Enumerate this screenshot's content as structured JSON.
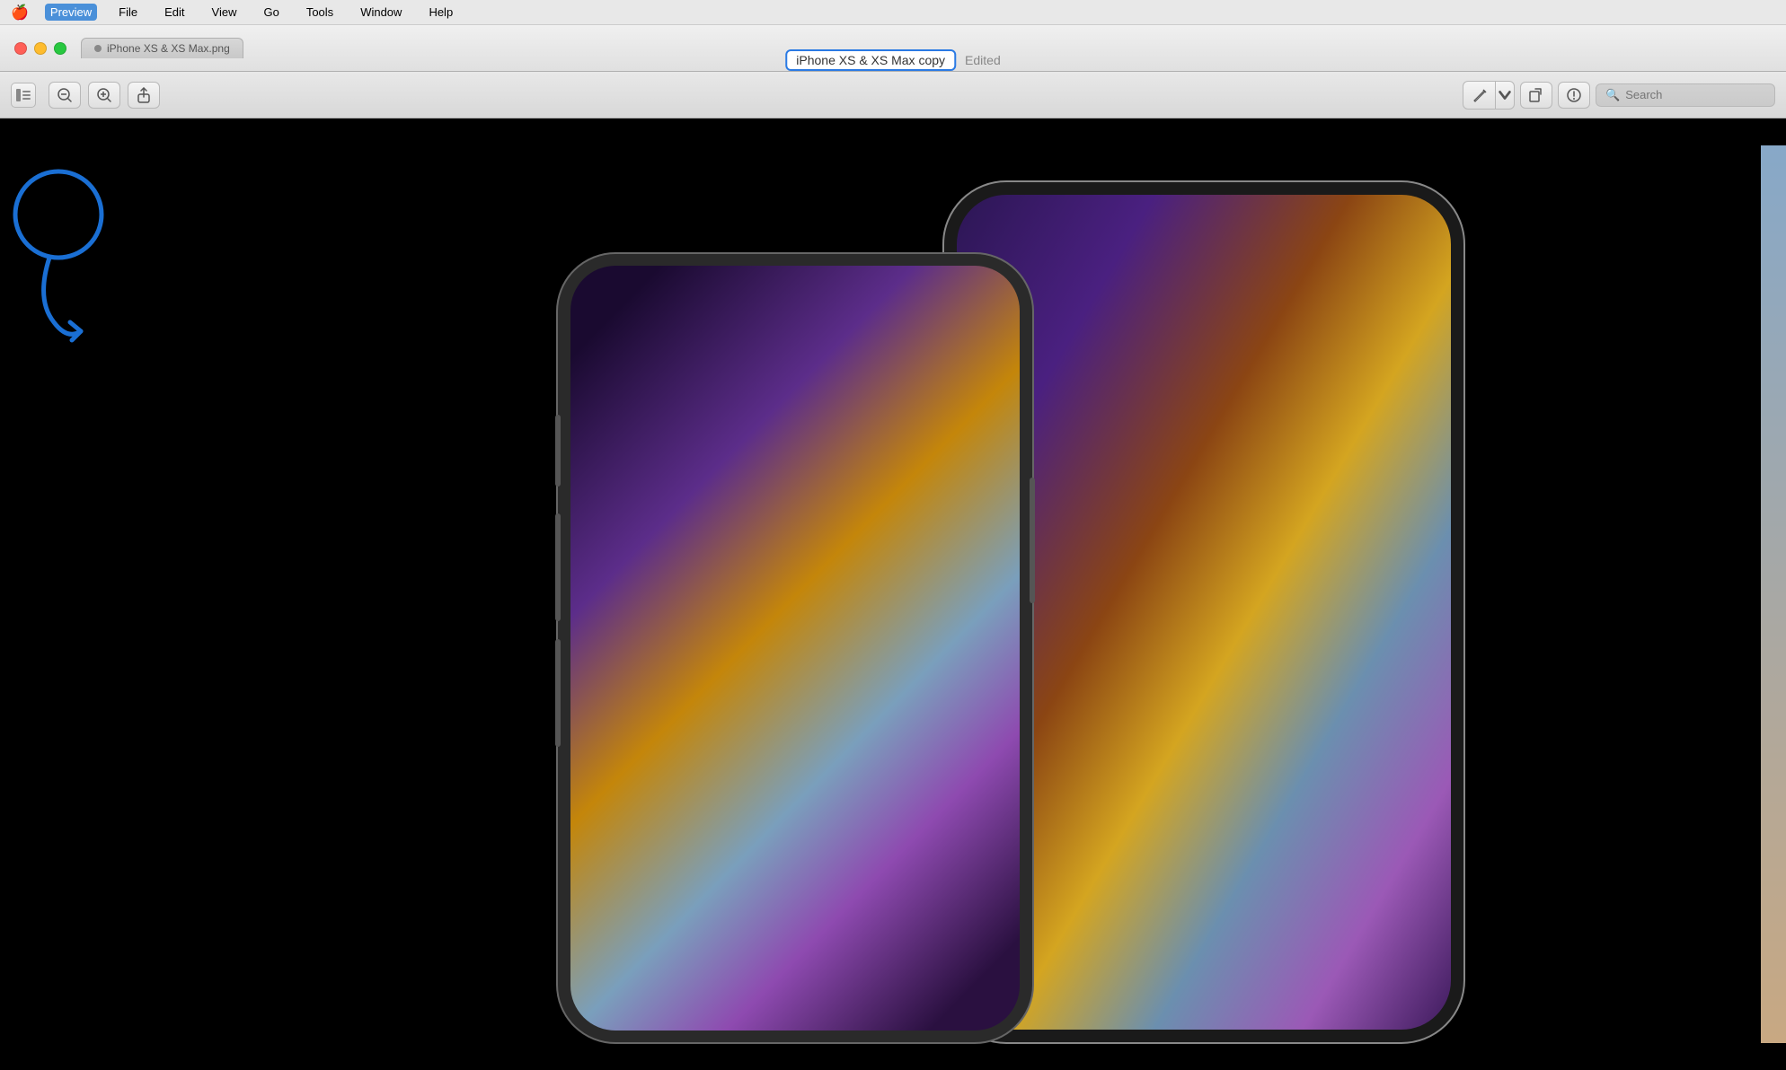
{
  "menubar": {
    "apple": "🍎",
    "items": [
      {
        "label": "Preview",
        "active": true
      },
      {
        "label": "File"
      },
      {
        "label": "Edit"
      },
      {
        "label": "View"
      },
      {
        "label": "Go"
      },
      {
        "label": "Tools"
      },
      {
        "label": "Window"
      },
      {
        "label": "Help"
      }
    ]
  },
  "titlebar": {
    "traffic_lights": {
      "close": "close",
      "minimize": "minimize",
      "maximize": "maximize"
    },
    "tab_filename": "iPhone XS & XS Max.png",
    "window_title": "iPhone XS & XS Max copy",
    "edited_label": "Edited"
  },
  "toolbar": {
    "sidebar_icon": "⊞",
    "zoom_out_label": "−",
    "zoom_in_label": "+",
    "share_label": "↑",
    "pen_label": "✏",
    "rotate_label": "↺",
    "markup_label": "◎",
    "search_placeholder": "Search"
  },
  "content": {
    "background": "#000000"
  },
  "annotation": {
    "circle_color": "#1a6fd4",
    "arrow_color": "#1a6fd4"
  }
}
